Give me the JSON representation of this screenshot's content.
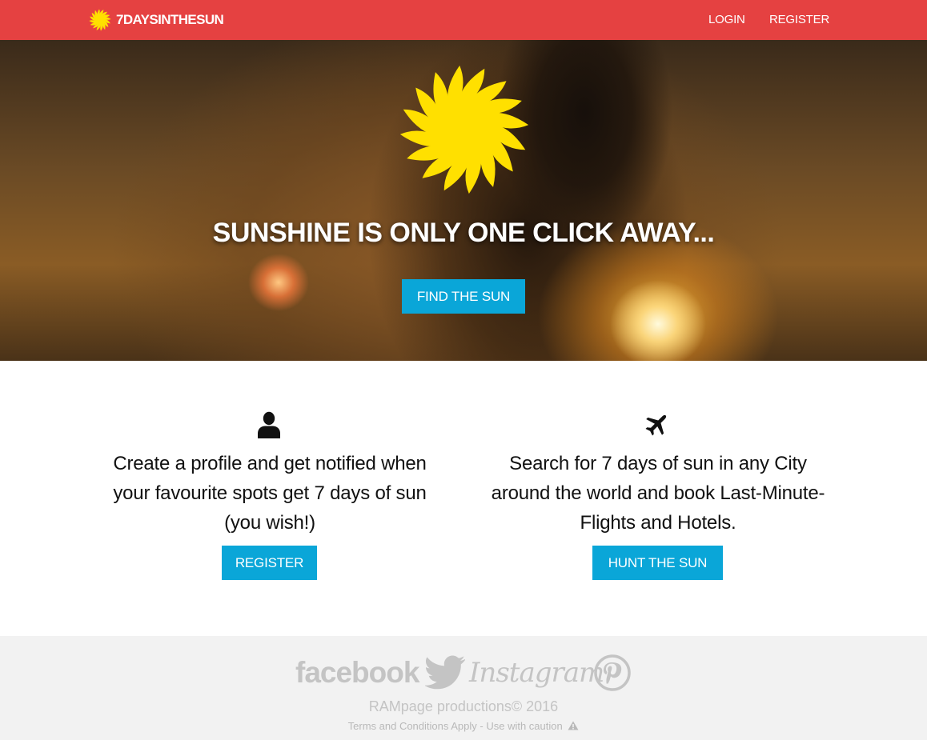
{
  "navbar": {
    "brand": "7DAYSINTHESUN",
    "brand_icon": "sun-icon",
    "links": {
      "login": "LOGIN",
      "register": "REGISTER"
    },
    "background": "#e54141"
  },
  "hero": {
    "icon": "sun-icon",
    "headline": "SUNSHINE IS ONLY ONE CLICK AWAY...",
    "button": "FIND THE SUN"
  },
  "features": {
    "left": {
      "icon": "user-icon",
      "text": "Create a profile and get notified when your favourite spots get 7 days of sun (you wish!)",
      "button": "REGISTER"
    },
    "right": {
      "icon": "airplane-icon",
      "text": "Search for 7 days of sun in any City around the world and book Last-Minute-Flights and Hotels.",
      "button": "HUNT THE SUN"
    }
  },
  "footer": {
    "social": {
      "facebook": "facebook",
      "twitter": "twitter-icon",
      "instagram": "Instagram",
      "pinterest": "pinterest-icon"
    },
    "copyright": "RAMpage productions© 2016",
    "terms": "Terms and Conditions Apply - Use with caution",
    "terms_icon": "warning-icon"
  },
  "colors": {
    "accent": "#0aa6d8",
    "sun": "#ffe000",
    "footer_bg": "#f2f2f2"
  }
}
